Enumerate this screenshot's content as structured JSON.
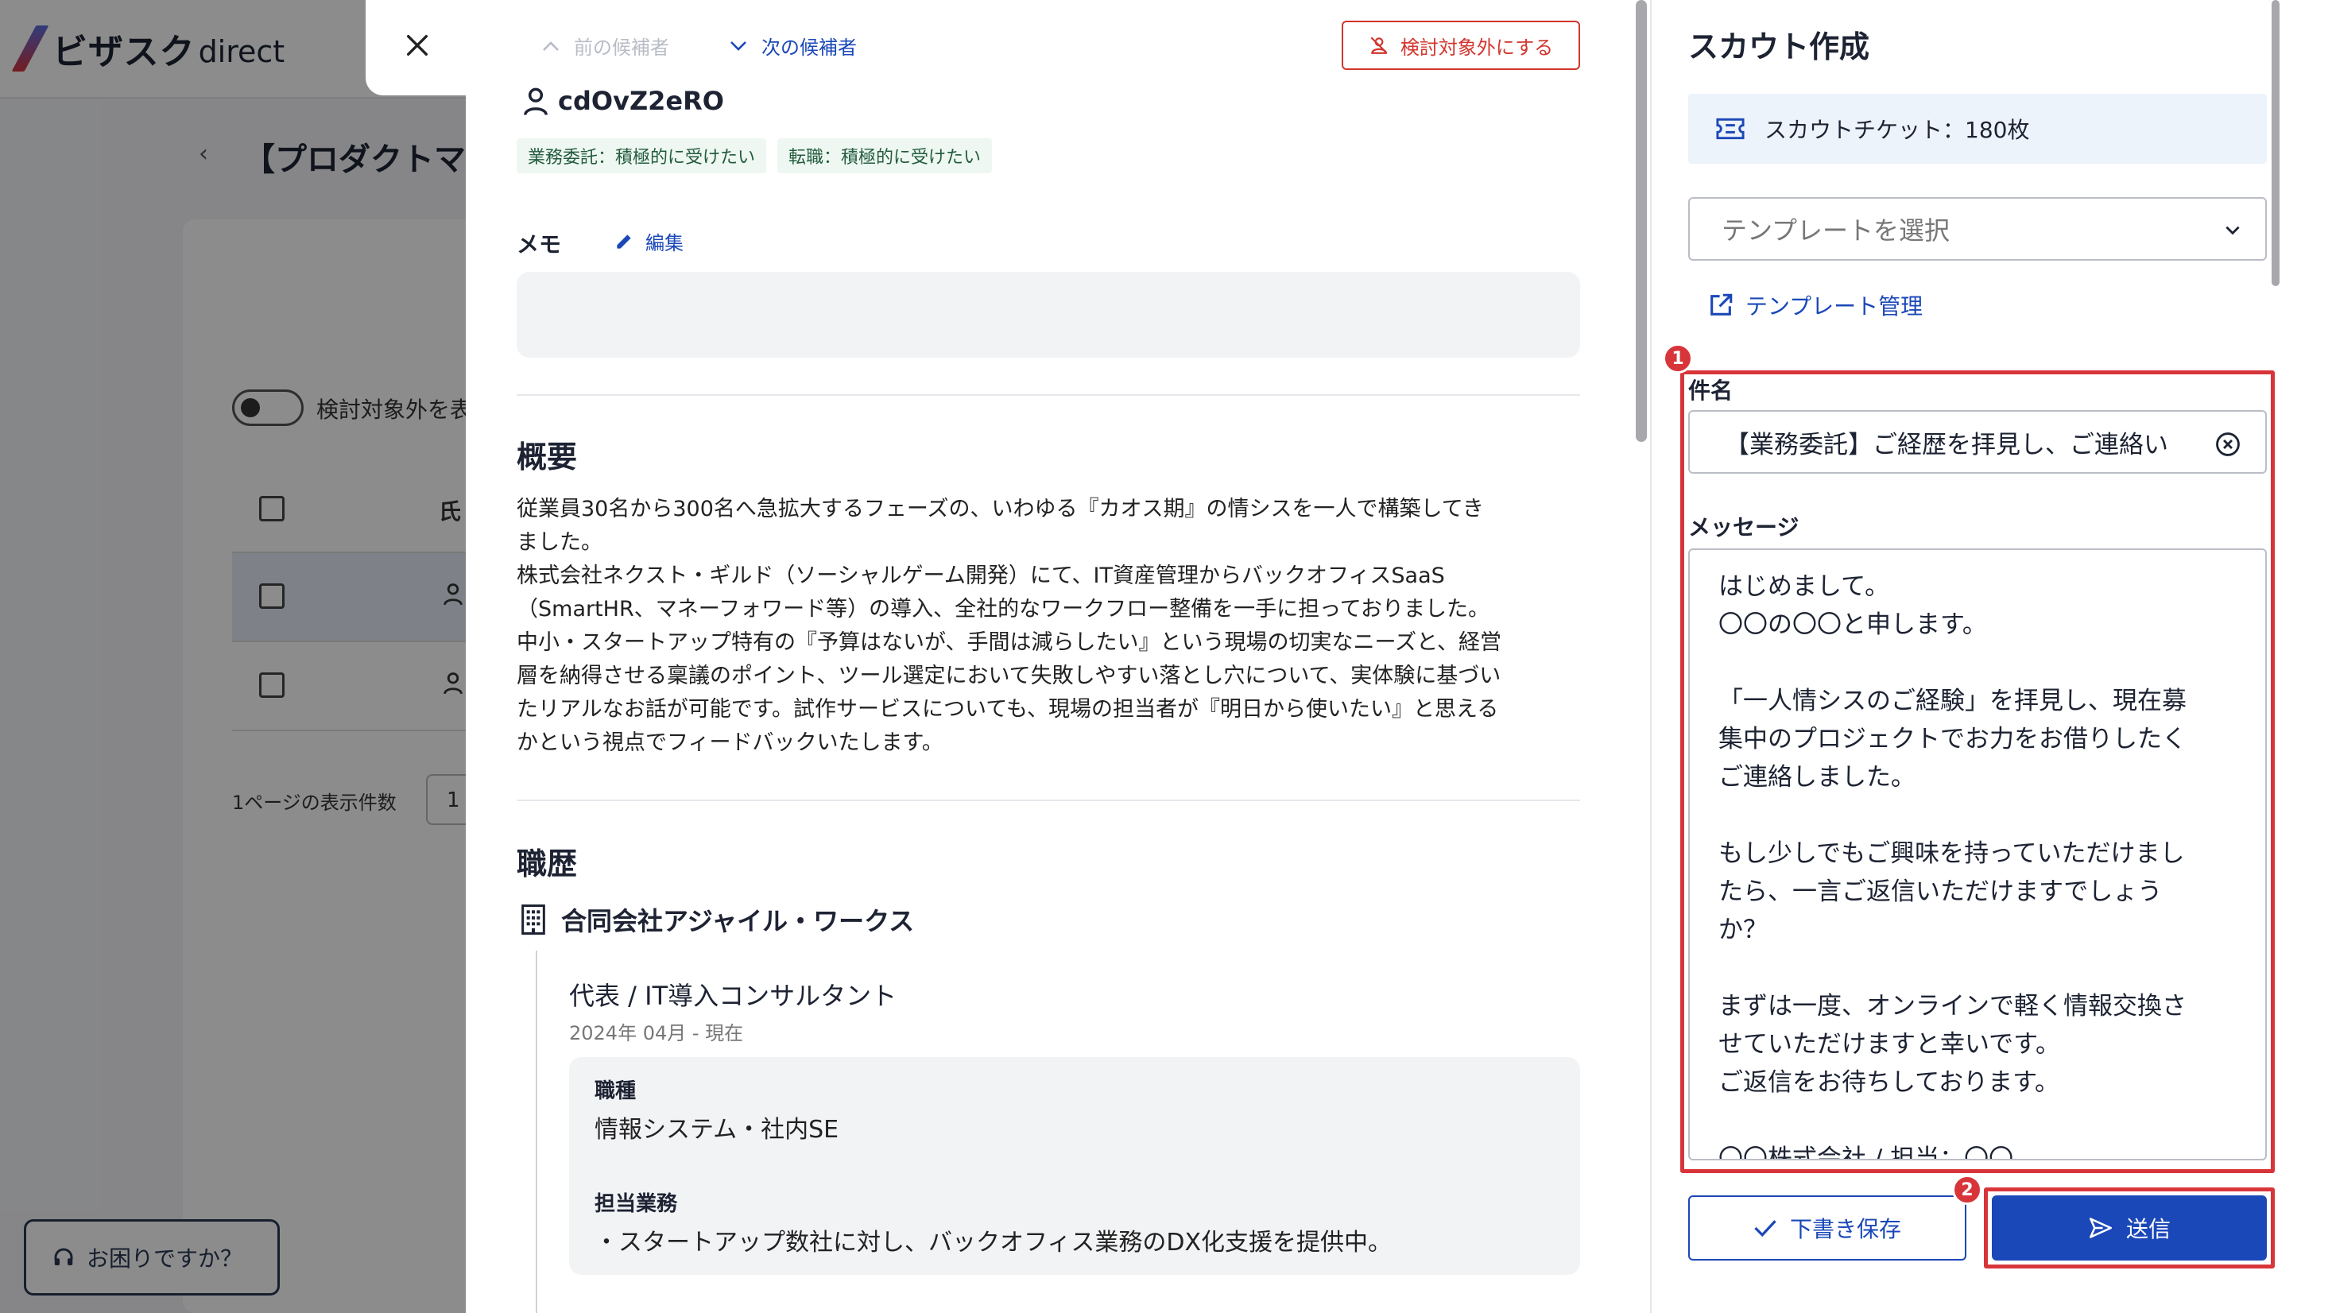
{
  "app": {
    "logo_main": "ビザスク",
    "logo_sub": "direct"
  },
  "background": {
    "back_symbol": "‹",
    "page_title": "【プロダクトマ",
    "toggle_label": "検討対象外を表",
    "column_label": "氏",
    "rows_per_page_label": "1ページの表示件数",
    "rows_per_page_value": "1",
    "help_button": "お困りですか？"
  },
  "drawer": {
    "prev_label": "前の候補者",
    "next_label": "次の候補者",
    "exclude_button": "検討対象外にする",
    "candidate_name": "cdOvZ2eRO",
    "tags": [
      "業務委託：積極的に受けたい",
      "転職：積極的に受けたい"
    ],
    "memo_label": "メモ",
    "memo_edit": "編集",
    "summary_title": "概要",
    "summary_lines": [
      "従業員30名から300名へ急拡大するフェーズの、いわゆる『カオス期』の情シスを一人で構築してき",
      "ました。",
      "株式会社ネクスト・ギルド（ソーシャルゲーム開発）にて、IT資産管理からバックオフィスSaaS",
      "（SmartHR、マネーフォワード等）の導入、全社的なワークフロー整備を一手に担っておりました。",
      "中小・スタートアップ特有の『予算はないが、手間は減らしたい』という現場の切実なニーズと、経営",
      "層を納得させる稟議のポイント、ツール選定において失敗しやすい落とし穴について、実体験に基づい",
      "たリアルなお話が可能です。試作サービスについても、現場の担当者が『明日から使いたい』と思える",
      "かという視点でフィードバックいたします。"
    ],
    "career_title": "職歴",
    "company": "合同会社アジャイル・ワークス",
    "role_title": "代表 / IT導入コンサルタント",
    "role_period": "2024年 04月 - 現在",
    "job_type_label": "職種",
    "job_type_value": "情報システム・社内SE",
    "duties_label": "担当業務",
    "duties_value": "・スタートアップ数社に対し、バックオフィス業務のDX化支援を提供中。"
  },
  "scout": {
    "title": "スカウト作成",
    "ticket": "スカウトチケット：180枚",
    "template_placeholder": "テンプレートを選択",
    "template_manage": "テンプレート管理",
    "subject_label": "件名",
    "subject_value": "【業務委託】ご経歴を拝見し、ご連絡い",
    "message_label": "メッセージ",
    "message_lines": [
      "はじめまして。",
      "〇〇の〇〇と申します。",
      "",
      "「一人情シスのご経験」を拝見し、現在募",
      "集中のプロジェクトでお力をお借りしたく",
      "ご連絡しました。",
      "",
      "もし少しでもご興味を持っていただけまし",
      "たら、一言ご返信いただけますでしょう",
      "か？",
      "",
      "まずは一度、オンラインで軽く情報交換さ",
      "せていただけますと幸いです。",
      "ご返信をお待ちしております。",
      "",
      "〇〇株式会社 / 担当：〇〇"
    ],
    "draft_button": "下書き保存",
    "send_button": "送信",
    "badge_1": "1",
    "badge_2": "2"
  },
  "colors": {
    "accent": "#1b48b8",
    "danger": "#d2362e",
    "highlight": "#d8353a"
  }
}
